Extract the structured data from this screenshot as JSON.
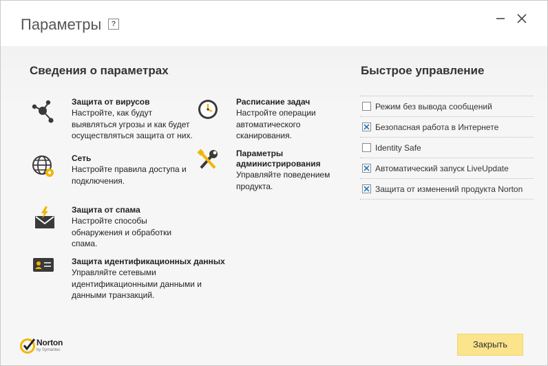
{
  "window": {
    "title": "Параметры",
    "help_label": "?"
  },
  "settings_info": {
    "title": "Сведения о параметрах",
    "items": [
      {
        "title": "Защита от вирусов",
        "description": "Настройте, как будут выявляться угрозы и как будет осуществляться защита от них.",
        "icon": "virus-protection-icon"
      },
      {
        "title": "Сеть",
        "description": "Настройте правила доступа и подключения.",
        "icon": "network-icon"
      },
      {
        "title": "Защита от спама",
        "description": "Настройте способы обнаружения и обработки спама.",
        "icon": "spam-protection-icon"
      },
      {
        "title": "Защита идентификационных данных",
        "description": "Управляйте сетевыми идентификационными данными и данными транзакций.",
        "icon": "identity-card-icon"
      },
      {
        "title": "Расписание задач",
        "description": "Настройте операции автоматического сканирования.",
        "icon": "clock-icon"
      },
      {
        "title": "Параметры администрирования",
        "description": "Управляйте поведением продукта.",
        "icon": "tools-icon"
      }
    ]
  },
  "quick_control": {
    "title": "Быстрое управление",
    "items": [
      {
        "label": "Режим без вывода сообщений",
        "checked": false
      },
      {
        "label": "Безопасная работа в Интернете",
        "checked": true
      },
      {
        "label": "Identity Safe",
        "checked": false
      },
      {
        "label": "Автоматический запуск LiveUpdate",
        "checked": true
      },
      {
        "label": "Защита от изменений продукта Norton",
        "checked": true
      }
    ]
  },
  "footer": {
    "close_label": "Закрыть",
    "logo_name": "Norton",
    "logo_sub": "by Symantec"
  },
  "colors": {
    "accent_yellow": "#fbe48c",
    "check_blue": "#2b7bbf",
    "icon_dark": "#3a3a3a",
    "icon_yellow": "#f2b500"
  }
}
